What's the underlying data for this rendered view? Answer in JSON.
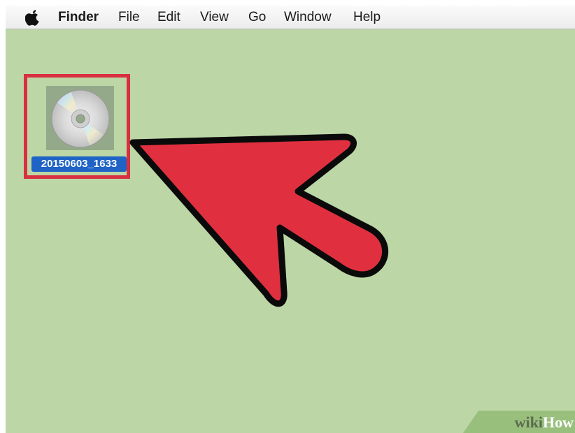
{
  "menubar": {
    "apple_menu_icon": "apple-icon",
    "items": [
      {
        "label": "Finder",
        "bold": true
      },
      {
        "label": "File"
      },
      {
        "label": "Edit"
      },
      {
        "label": "View"
      },
      {
        "label": "Go"
      },
      {
        "label": "Window"
      },
      {
        "label": "Help"
      }
    ]
  },
  "desktop": {
    "background_color": "#bcd6a6",
    "icon": {
      "type": "disc-image-icon",
      "label": "20150603_1633",
      "selected": true
    },
    "highlight_color": "#d8303e",
    "arrow_color": "#e03040"
  },
  "watermark": {
    "wiki": "wiki",
    "how": "How"
  }
}
